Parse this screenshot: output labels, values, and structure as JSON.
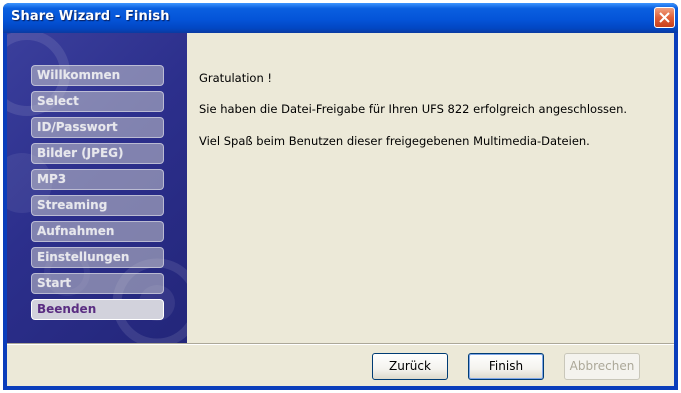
{
  "window": {
    "title": "Share Wizard - Finish",
    "close_icon": "close-icon"
  },
  "sidebar": {
    "items": [
      {
        "label": "Willkommen",
        "active": false
      },
      {
        "label": "Select",
        "active": false
      },
      {
        "label": "ID/Passwort",
        "active": false
      },
      {
        "label": "Bilder (JPEG)",
        "active": false
      },
      {
        "label": "MP3",
        "active": false
      },
      {
        "label": "Streaming",
        "active": false
      },
      {
        "label": "Aufnahmen",
        "active": false
      },
      {
        "label": "Einstellungen",
        "active": false
      },
      {
        "label": "Start",
        "active": false
      },
      {
        "label": "Beenden",
        "active": true
      }
    ]
  },
  "content": {
    "line1": "Gratulation !",
    "line2": "Sie haben die Datei-Freigabe für Ihren UFS 822 erfolgreich angeschlossen.",
    "line3": "Viel Spaß beim Benutzen dieser freigegebenen Multimedia-Dateien."
  },
  "buttons": {
    "back": "Zurück",
    "finish": "Finish",
    "cancel": "Abbrechen"
  },
  "colors": {
    "titlebar": "#0454d8",
    "sidebar": "#2c2f8c",
    "active_item_text": "#5a2d82",
    "dialog_bg": "#ece9d8"
  }
}
